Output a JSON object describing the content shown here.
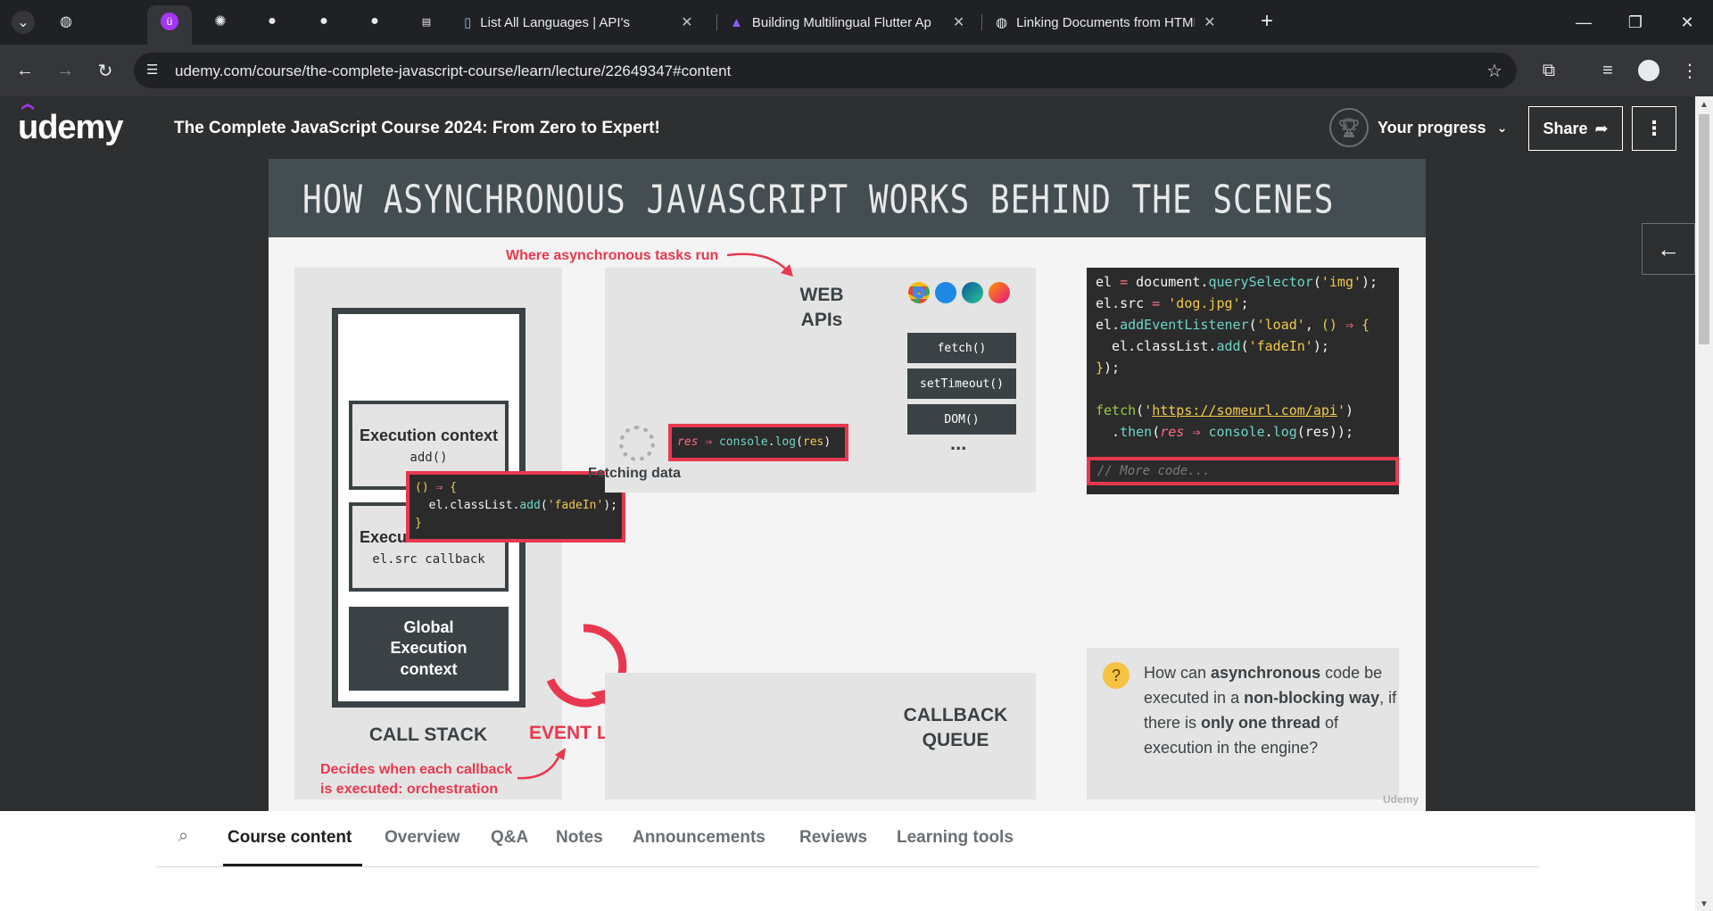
{
  "browser": {
    "tabs": [
      {
        "title": "List All Languages | API's"
      },
      {
        "title": "Building Multilingual Flutter Ap"
      },
      {
        "title": "Linking Documents from HTML"
      }
    ],
    "tab_close": "✕",
    "new_tab": "+",
    "url": "udemy.com/course/the-complete-javascript-course/learn/lecture/22649347#content"
  },
  "header": {
    "logo": "udemy",
    "course_title": "The Complete JavaScript Course 2024: From Zero to Expert!",
    "progress_label": "Your progress",
    "share_label": "Share"
  },
  "slide": {
    "title": "HOW ASYNCHRONOUS JAVASCRIPT WORKS BEHIND THE SCENES",
    "async_note": "Where asynchronous tasks run",
    "web_apis": "WEB APIs",
    "api_buttons": [
      "fetch()",
      "setTimeout()",
      "DOM()"
    ],
    "ellipsis": "...",
    "fetching": "Fetching data",
    "ctx1_title": "Execution context",
    "ctx1_sub": "add()",
    "ctx2_title": "Execution context",
    "ctx2_sub": "el.src callback",
    "global_ctx": "Global Execution context",
    "call_stack": "CALL STACK",
    "event_loop": "EVENT LOOP",
    "callback_queue": "CALLBACK QUEUE",
    "orchestration_note_1": "Decides when each callback",
    "orchestration_note_2": "is executed: orchestration",
    "more_code": "// More code...",
    "question_parts": [
      "How can ",
      "asynchronous",
      " code be executed in a ",
      "non-blocking way",
      ", if there is ",
      "only one thread",
      " of execution in the engine?"
    ],
    "watermark": "Udemy"
  },
  "bottom_tabs": [
    {
      "label": "Course content",
      "active": true
    },
    {
      "label": "Overview"
    },
    {
      "label": "Q&A"
    },
    {
      "label": "Notes"
    },
    {
      "label": "Announcements"
    },
    {
      "label": "Reviews"
    },
    {
      "label": "Learning tools"
    }
  ]
}
